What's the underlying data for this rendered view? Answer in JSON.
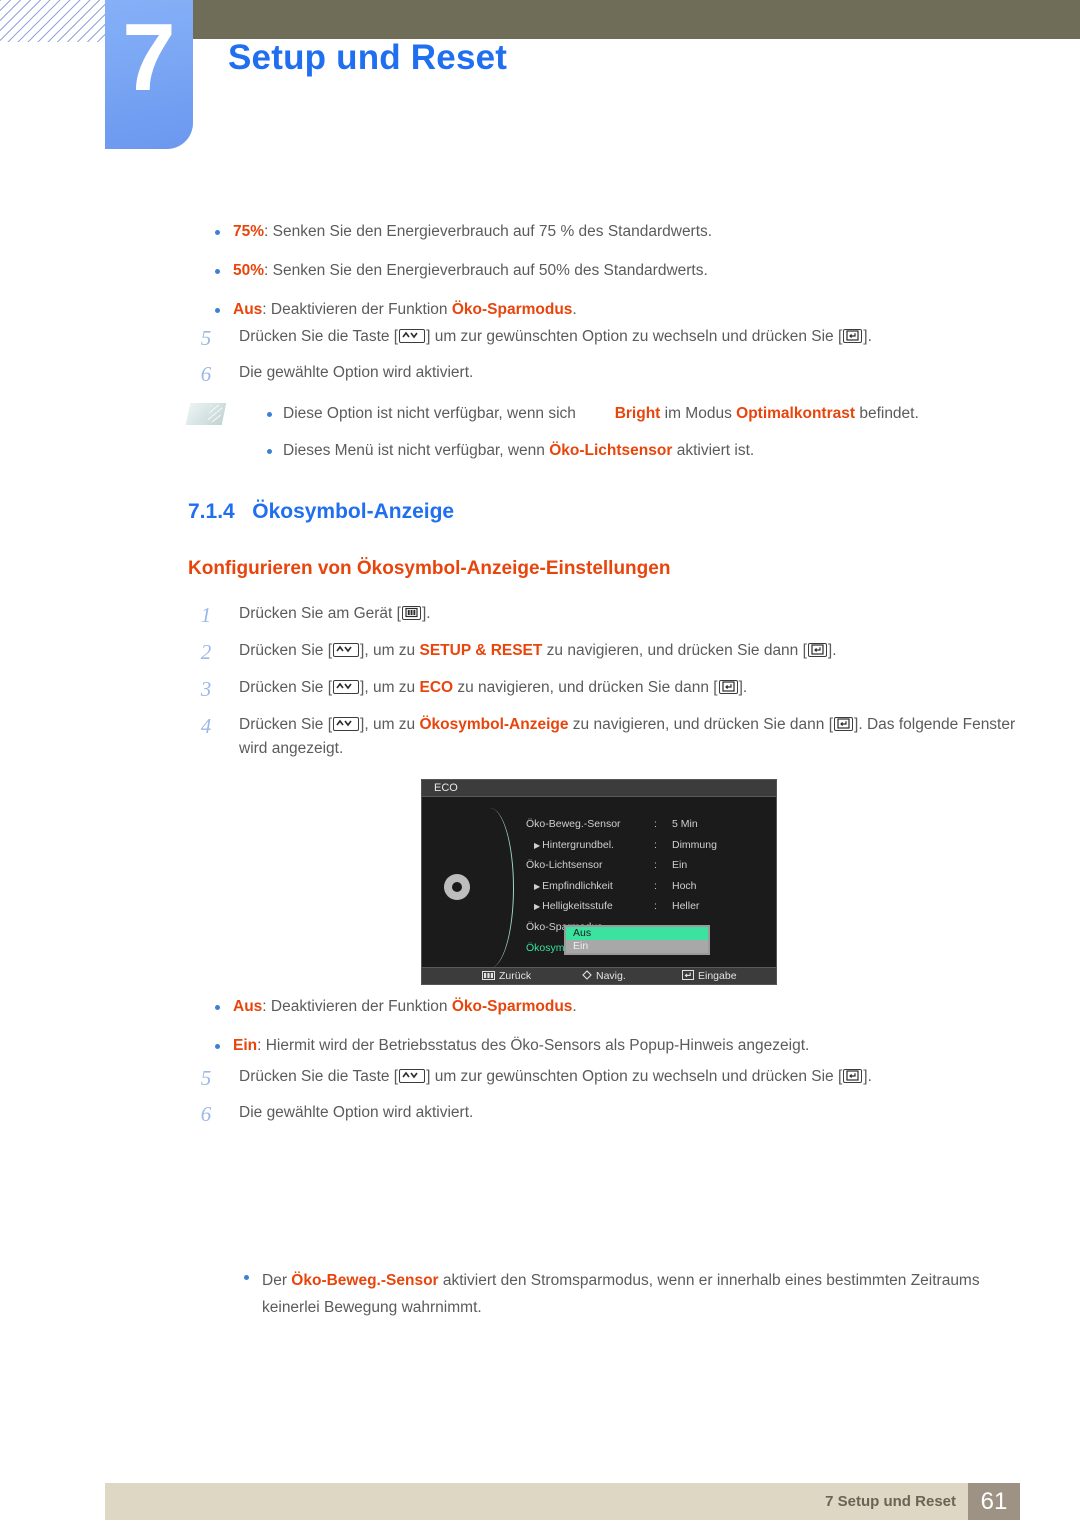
{
  "header": {
    "chapter_number": "7",
    "chapter_title": "Setup und Reset",
    "band_color": "#6f6d57",
    "block_color": "#7aa6f4",
    "title_color": "#1f6ff0"
  },
  "top_bullets": [
    {
      "term": "75%",
      "rest": ": Senken Sie den Energieverbrauch auf 75 % des Standardwerts."
    },
    {
      "term": "50%",
      "rest": ": Senken Sie den Energieverbrauch auf 50% des Standardwerts."
    },
    {
      "term": "Aus",
      "rest_a": ": Deaktivieren der Funktion ",
      "term2": "Öko-Sparmodus",
      "rest_b": "."
    }
  ],
  "top_steps": [
    {
      "num": "5",
      "a": "Drücken Sie die Taste [",
      "key1": "up-down",
      "b": "] um zur gewünschten Option zu wechseln und drücken Sie [",
      "key2": "enter",
      "c": "]."
    },
    {
      "num": "6",
      "a": "Die gewählte Option wird aktiviert."
    }
  ],
  "note_top": {
    "icon": "note-pencil-icon",
    "items": [
      {
        "a": "Diese Option ist nicht verfügbar, wenn sich",
        "gap": "         ",
        "b": "Bright",
        "c": " im Modus ",
        "d": "Optimalkontrast",
        "e": " befindet."
      },
      {
        "a": "Dieses Menü ist nicht verfügbar, wenn ",
        "b": "Öko-Lichtsensor",
        "c": " aktiviert ist."
      }
    ]
  },
  "section": {
    "number": "7.1.4",
    "title": "Ökosymbol-Anzeige",
    "subtitle": "Konfigurieren von Ökosymbol-Anzeige-Einstellungen"
  },
  "steps": [
    {
      "num": "1",
      "a": "Drücken Sie am Gerät [",
      "key1": "menu",
      "b": "]."
    },
    {
      "num": "2",
      "a": "Drücken Sie [",
      "key1": "up-down",
      "b": "], um zu ",
      "hl": "SETUP & RESET",
      "c": " zu navigieren, und drücken Sie dann [",
      "key2": "enter",
      "d": "]."
    },
    {
      "num": "3",
      "a": "Drücken Sie [",
      "key1": "up-down",
      "b": "], um zu ",
      "hl": "ECO",
      "c": " zu navigieren, und drücken Sie dann [",
      "key2": "enter",
      "d": "]."
    },
    {
      "num": "4",
      "a": "Drücken Sie [",
      "key1": "up-down",
      "b": "], um zu ",
      "hl": "Ökosymbol-Anzeige",
      "c": " zu navigieren, und drücken Sie dann [",
      "key2": "enter",
      "d": "]. Das folgende Fenster wird angezeigt."
    }
  ],
  "osd": {
    "title": "ECO",
    "icon": "gear-icon",
    "rows": [
      {
        "label": "Öko-Beweg.-Sensor",
        "indent": false,
        "value": "5 Min",
        "colon": ":",
        "selected": false
      },
      {
        "label": "Hintergrundbel.",
        "indent": true,
        "value": "Dimmung",
        "colon": ":",
        "selected": false
      },
      {
        "label": "Öko-Lichtsensor",
        "indent": false,
        "value": "Ein",
        "colon": ":",
        "selected": false
      },
      {
        "label": "Empfindlichkeit",
        "indent": true,
        "value": "Hoch",
        "colon": ":",
        "selected": false
      },
      {
        "label": "Helligkeitsstufe",
        "indent": true,
        "value": "Heller",
        "colon": ":",
        "selected": false
      },
      {
        "label": "Öko-Sparmodus",
        "indent": false,
        "value": "",
        "colon": "",
        "selected": false
      },
      {
        "label": "Ökosymbol-Anzeige",
        "indent": false,
        "value": "",
        "colon": ":",
        "selected": true
      }
    ],
    "popup": {
      "options": [
        {
          "label": "Aus",
          "state": "selected"
        },
        {
          "label": "Ein",
          "state": "normal"
        }
      ],
      "highlight_color": "#3ce2a0"
    },
    "footer": [
      {
        "icon": "menu-icon",
        "label": "Zurück"
      },
      {
        "icon": "diamond-icon",
        "label": "Navig."
      },
      {
        "icon": "enter-icon",
        "label": "Eingabe"
      }
    ]
  },
  "bottom_bullets": [
    {
      "term": "Aus",
      "rest_a": ": Deaktivieren der Funktion ",
      "term2": "Öko-Sparmodus",
      "rest_b": "."
    },
    {
      "term": "Ein",
      "rest_a": ": Hiermit wird der Betriebsstatus des Öko-Sensors als Popup-Hinweis angezeigt.",
      "term2": "",
      "rest_b": ""
    }
  ],
  "bottom_steps": [
    {
      "num": "5",
      "a": "Drücken Sie die Taste [",
      "key1": "up-down",
      "b": "] um zur gewünschten Option zu wechseln und drücken Sie [",
      "key2": "enter",
      "c": "]."
    },
    {
      "num": "6",
      "a": "Die gewählte Option wird aktiviert."
    }
  ],
  "note_bottom": {
    "a": "Der ",
    "b": "Öko-Beweg.-Sensor",
    "c": " aktiviert den Stromsparmodus, wenn er innerhalb eines bestimmten Zeitraums keinerlei Bewegung wahrnimmt."
  },
  "footer": {
    "text": "7 Setup und Reset",
    "page": "61",
    "bar_color": "#ddd7c3",
    "page_color": "#9e9284"
  }
}
